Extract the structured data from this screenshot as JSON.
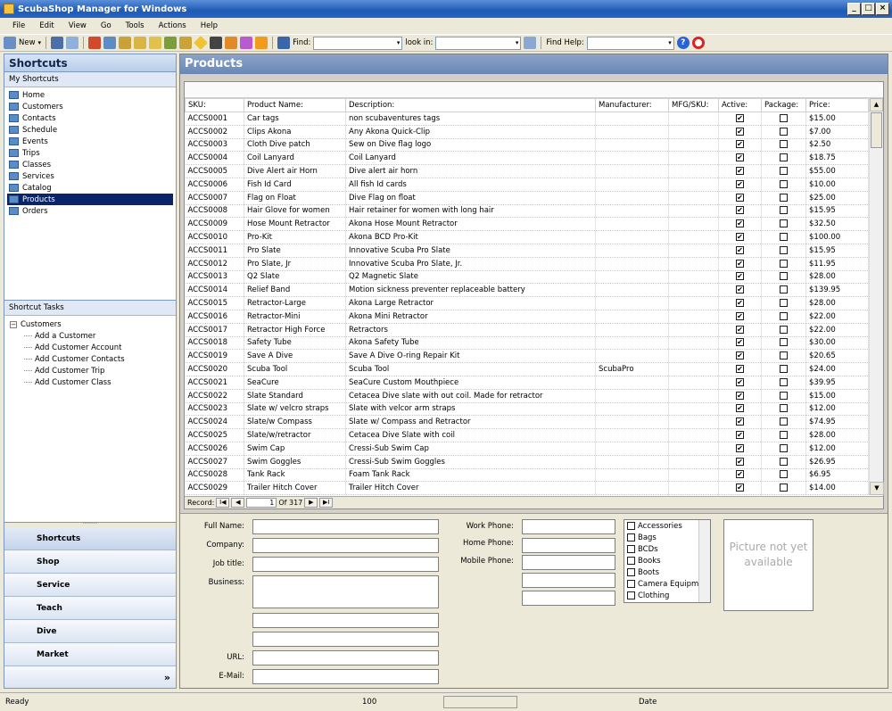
{
  "window": {
    "title": "ScubaShop Manager for Windows"
  },
  "menu": [
    "File",
    "Edit",
    "View",
    "Go",
    "Tools",
    "Actions",
    "Help"
  ],
  "toolbar": {
    "new_label": "New",
    "find_label": "Find:",
    "look_in_label": "look in:",
    "find_help_label": "Find Help:"
  },
  "shortcuts": {
    "header": "Shortcuts",
    "subheader": "My Shortcuts",
    "items": [
      "Home",
      "Customers",
      "Contacts",
      "Schedule",
      "Events",
      "Trips",
      "Classes",
      "Services",
      "Catalog",
      "Products",
      "Orders"
    ],
    "selected": "Products"
  },
  "tasks": {
    "header": "Shortcut Tasks",
    "root": "Customers",
    "items": [
      "Add a Customer",
      "Add Customer Account",
      "Add Customer Contacts",
      "Add Customer Trip",
      "Add Customer Class"
    ]
  },
  "nav": {
    "buttons": [
      "Shortcuts",
      "Shop",
      "Service",
      "Teach",
      "Dive",
      "Market"
    ],
    "more": "»"
  },
  "main": {
    "title": "Products"
  },
  "grid": {
    "columns": [
      "SKU:",
      "Product Name:",
      "Description:",
      "Manufacturer:",
      "MFG/SKU:",
      "Active:",
      "Package:",
      "Price:"
    ],
    "rows": [
      [
        "ACCS0001",
        "Car tags",
        "non scubaventures tags",
        "",
        "",
        true,
        false,
        "$15.00"
      ],
      [
        "ACCS0002",
        "Clips Akona",
        "Any Akona Quick-Clip",
        "",
        "",
        true,
        false,
        "$7.00"
      ],
      [
        "ACCS0003",
        "Cloth Dive patch",
        "Sew on Dive flag logo",
        "",
        "",
        true,
        false,
        "$2.50"
      ],
      [
        "ACCS0004",
        "Coil Lanyard",
        "Coil Lanyard",
        "",
        "",
        true,
        false,
        "$18.75"
      ],
      [
        "ACCS0005",
        "Dive Alert air Horn",
        "Dive alert air horn",
        "",
        "",
        true,
        false,
        "$55.00"
      ],
      [
        "ACCS0006",
        "Fish Id Card",
        "All fish Id cards",
        "",
        "",
        true,
        false,
        "$10.00"
      ],
      [
        "ACCS0007",
        "Flag on Float",
        "Dive Flag on float",
        "",
        "",
        true,
        false,
        "$25.00"
      ],
      [
        "ACCS0008",
        "Hair Glove for women",
        "Hair retainer for women with long hair",
        "",
        "",
        true,
        false,
        "$15.95"
      ],
      [
        "ACCS0009",
        "Hose Mount Retractor",
        "Akona Hose Mount Retractor",
        "",
        "",
        true,
        false,
        "$32.50"
      ],
      [
        "ACCS0010",
        "Pro-Kit",
        "Akona BCD Pro-Kit",
        "",
        "",
        true,
        false,
        "$100.00"
      ],
      [
        "ACCS0011",
        "Pro Slate",
        "Innovative Scuba Pro Slate",
        "",
        "",
        true,
        false,
        "$15.95"
      ],
      [
        "ACCS0012",
        "Pro Slate, Jr",
        "Innovative Scuba Pro Slate, Jr.",
        "",
        "",
        true,
        false,
        "$11.95"
      ],
      [
        "ACCS0013",
        "Q2 Slate",
        "Q2 Magnetic Slate",
        "",
        "",
        true,
        false,
        "$28.00"
      ],
      [
        "ACCS0014",
        "Relief Band",
        "Motion sickness preventer replaceable battery",
        "",
        "",
        true,
        false,
        "$139.95"
      ],
      [
        "ACCS0015",
        "Retractor-Large",
        "Akona Large Retractor",
        "",
        "",
        true,
        false,
        "$28.00"
      ],
      [
        "ACCS0016",
        "Retractor-Mini",
        "Akona Mini Retractor",
        "",
        "",
        true,
        false,
        "$22.00"
      ],
      [
        "ACCS0017",
        "Retractor High Force",
        "Retractors",
        "",
        "",
        true,
        false,
        "$22.00"
      ],
      [
        "ACCS0018",
        "Safety Tube",
        "Akona Safety Tube",
        "",
        "",
        true,
        false,
        "$30.00"
      ],
      [
        "ACCS0019",
        "Save A Dive",
        "Save A Dive O-ring Repair Kit",
        "",
        "",
        true,
        false,
        "$20.65"
      ],
      [
        "ACCS0020",
        "Scuba Tool",
        "Scuba Tool",
        "ScubaPro",
        "",
        true,
        false,
        "$24.00"
      ],
      [
        "ACCS0021",
        "SeaCure",
        "SeaCure Custom Mouthpiece",
        "",
        "",
        true,
        false,
        "$39.95"
      ],
      [
        "ACCS0022",
        "Slate Standard",
        "Cetacea Dive slate with out coil. Made for retractor",
        "",
        "",
        true,
        false,
        "$15.00"
      ],
      [
        "ACCS0023",
        "Slate w/ velcro straps",
        "Slate with velcor arm straps",
        "",
        "",
        true,
        false,
        "$12.00"
      ],
      [
        "ACCS0024",
        "Slate/w Compass",
        "Slate w/ Compass and Retractor",
        "",
        "",
        true,
        false,
        "$74.95"
      ],
      [
        "ACCS0025",
        "Slate/w/retractor",
        "Cetacea Dive Slate with coil",
        "",
        "",
        true,
        false,
        "$28.00"
      ],
      [
        "ACCS0026",
        "Swim Cap",
        "Cressi-Sub Swim Cap",
        "",
        "",
        true,
        false,
        "$12.00"
      ],
      [
        "ACCS0027",
        "Swim Goggles",
        "Cressi-Sub Swim Goggles",
        "",
        "",
        true,
        false,
        "$26.95"
      ],
      [
        "ACCS0028",
        "Tank Rack",
        "Foam Tank Rack",
        "",
        "",
        true,
        false,
        "$6.95"
      ],
      [
        "ACCS0029",
        "Trailer Hitch Cover",
        "Trailer Hitch Cover",
        "",
        "",
        true,
        false,
        "$14.00"
      ]
    ],
    "record_label": "Record:",
    "record_current": "1",
    "record_of": "Of 317"
  },
  "form": {
    "full_name": "Full Name:",
    "company": "Company:",
    "job_title": "Job title:",
    "business": "Business:",
    "url": "URL:",
    "email": "E-Mail:",
    "work_phone": "Work Phone:",
    "home_phone": "Home Phone:",
    "mobile_phone": "Mobile Phone:",
    "categories": [
      "Accessories",
      "Bags",
      "BCDs",
      "Books",
      "Boots",
      "Camera Equipmen",
      "Clothing"
    ],
    "picture_text": "Picture not yet available"
  },
  "status": {
    "left": "Ready",
    "middle": "100",
    "right": "Date"
  }
}
